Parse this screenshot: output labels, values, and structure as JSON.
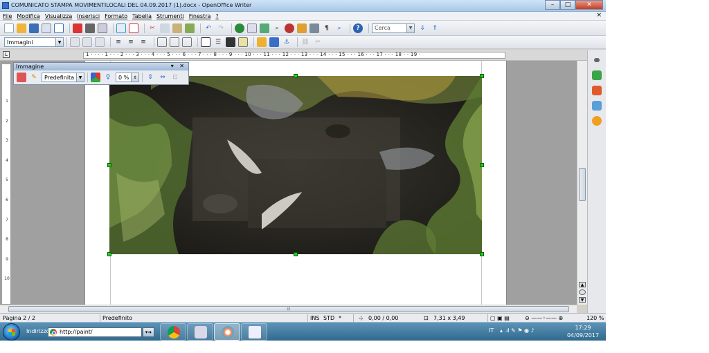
{
  "window": {
    "title": "COMUNICATO STAMPA MOVIMENTILOCALI DEL 04.09.2017 (1).docx - OpenOffice Writer",
    "minimize_glyph": "–",
    "maximize_glyph": "□",
    "close_glyph": "✕",
    "doc_close_glyph": "×"
  },
  "menu": [
    "File",
    "Modifica",
    "Visualizza",
    "Inserisci",
    "Formato",
    "Tabella",
    "Strumenti",
    "Finestra",
    "?"
  ],
  "toolbar": {
    "search_placeholder": "Cerca",
    "style_value": "Immagini"
  },
  "ruler": {
    "corner_glyph": "L",
    "numbers": "1 · · · · 1 · · · 2 · · · 3 · · · 4 · · · 5 · · · 6 · · · 7 · · · 8 · · · 9 · · · 10 · · · 11 · · · 12 · · · 13 · · · 14 · · · 15 · · · 16 · · · 17 · · · 18 · · 19 ·",
    "vertical_numbers": [
      "1",
      "2",
      "3",
      "4",
      "5",
      "6",
      "7",
      "8",
      "9",
      "10"
    ]
  },
  "image_toolbar": {
    "title": "Immagine",
    "controls": "▾ ✕",
    "filter_value": "Predefinita",
    "transparency_value": "0 %"
  },
  "scroll": {
    "hscroll_grip": "⦙⦙⦙",
    "up_glyph": "▲",
    "down_glyph": "▼"
  },
  "status": {
    "page": "Pagina 2 / 2",
    "style": "Predefinito",
    "ins": "INS",
    "std": "STD",
    "star": "*",
    "position": "0,00 / 0,00",
    "size": "7,31 x 3,49",
    "zoom": "120 %"
  },
  "taskbar": {
    "address_label": "Indirizzo",
    "address_value": "http://paint/",
    "language": "IT",
    "time": "17:29",
    "date": "04/09/2017"
  },
  "colors": {
    "accent": "#3a6ec7",
    "selection_handle": "#29c829",
    "taskbar": "#2f6a8f"
  }
}
